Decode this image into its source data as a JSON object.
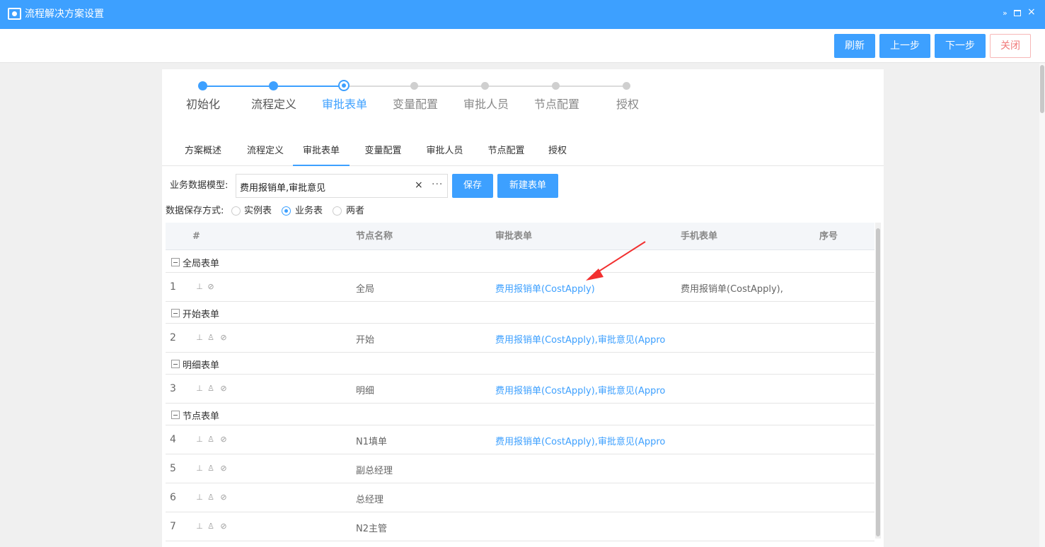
{
  "window": {
    "title": "流程解决方案设置",
    "controls": [
      "»",
      "□",
      "×"
    ]
  },
  "toolbar": {
    "refresh": "刷新",
    "prev": "上一步",
    "next": "下一步",
    "close": "关闭"
  },
  "steps": [
    {
      "label": "初始化",
      "state": "done"
    },
    {
      "label": "流程定义",
      "state": "done"
    },
    {
      "label": "审批表单",
      "state": "active"
    },
    {
      "label": "变量配置",
      "state": "todo"
    },
    {
      "label": "审批人员",
      "state": "todo"
    },
    {
      "label": "节点配置",
      "state": "todo"
    },
    {
      "label": "授权",
      "state": "todo"
    }
  ],
  "tabs": [
    "方案概述",
    "流程定义",
    "审批表单",
    "变量配置",
    "审批人员",
    "节点配置",
    "授权"
  ],
  "active_tab": "审批表单",
  "form": {
    "model_label": "业务数据模型:",
    "model_value": "费用报销单,审批意见",
    "clear_icon": "×",
    "more_icon": "···",
    "save": "保存",
    "new_form": "新建表单",
    "save_mode_label": "数据保存方式:",
    "save_modes": [
      "实例表",
      "业务表",
      "两者"
    ],
    "save_mode_selected": "业务表"
  },
  "table": {
    "headers": [
      "#",
      "节点名称",
      "审批表单",
      "手机表单",
      "序号"
    ],
    "groups": [
      {
        "name": "全局表单",
        "rows": [
          {
            "num": "1",
            "node": "全局",
            "form": "费用报销单(CostApply)",
            "mobile": "费用报销单(CostApply),",
            "icons": [
              "stamp-icon",
              "forbid-icon"
            ]
          }
        ]
      },
      {
        "name": "开始表单",
        "rows": [
          {
            "num": "2",
            "node": "开始",
            "form": "费用报销单(CostApply),审批意见(Appro",
            "mobile": "",
            "icons": [
              "stamp-icon",
              "user-icon",
              "forbid-icon"
            ]
          }
        ]
      },
      {
        "name": "明细表单",
        "rows": [
          {
            "num": "3",
            "node": "明细",
            "form": "费用报销单(CostApply),审批意见(Appro",
            "mobile": "",
            "icons": [
              "stamp-icon",
              "user-icon",
              "forbid-icon"
            ]
          }
        ]
      },
      {
        "name": "节点表单",
        "rows": [
          {
            "num": "4",
            "node": "N1填单",
            "form": "费用报销单(CostApply),审批意见(Appro",
            "mobile": "",
            "icons": [
              "stamp-icon",
              "user-icon",
              "forbid-icon"
            ]
          },
          {
            "num": "5",
            "node": "副总经理",
            "form": "",
            "mobile": "",
            "icons": [
              "stamp-icon",
              "user-icon",
              "forbid-icon"
            ]
          },
          {
            "num": "6",
            "node": "总经理",
            "form": "",
            "mobile": "",
            "icons": [
              "stamp-icon",
              "user-icon",
              "forbid-icon"
            ]
          },
          {
            "num": "7",
            "node": "N2主管",
            "form": "",
            "mobile": "",
            "icons": [
              "stamp-icon",
              "user-icon",
              "forbid-icon"
            ]
          }
        ]
      }
    ]
  },
  "colors": {
    "primary": "#3da0ff",
    "annotation_arrow": "#f23030"
  }
}
